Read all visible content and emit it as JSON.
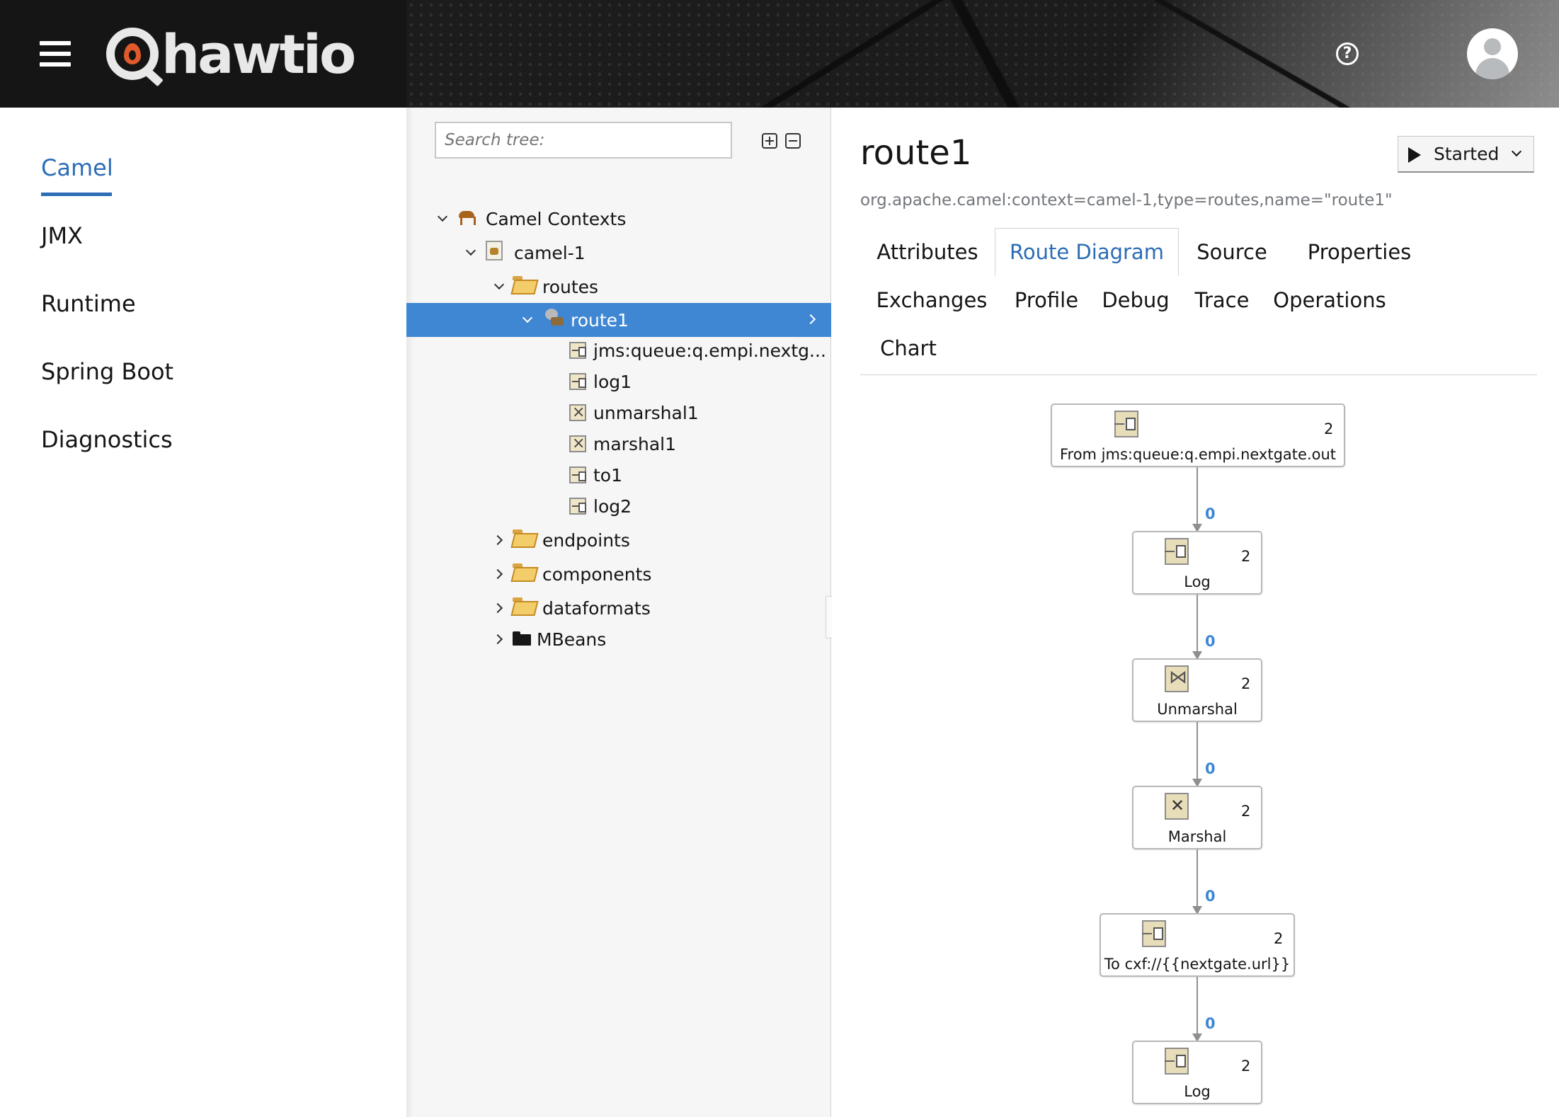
{
  "header": {
    "logo_text": "hawtio",
    "menu_icon": "hamburger-icon",
    "help_icon": "help-circle-icon",
    "avatar_icon": "user-avatar-icon"
  },
  "nav": {
    "active": "Camel",
    "items": [
      "Camel",
      "JMX",
      "Runtime",
      "Spring Boot",
      "Diagnostics"
    ]
  },
  "tree": {
    "search_placeholder": "Search tree:",
    "expand_all_icon": "plus-square-icon",
    "collapse_all_icon": "minus-square-icon",
    "rows": [
      {
        "label": "Camel Contexts",
        "icon": "camel-icon",
        "chevron": "down"
      },
      {
        "label": "camel-1",
        "icon": "context-icon",
        "chevron": "down"
      },
      {
        "label": "routes",
        "icon": "folder-open-icon",
        "chevron": "down"
      },
      {
        "label": "route1",
        "icon": "route-icon",
        "chevron": "down",
        "selected": true
      },
      {
        "label": "jms:queue:q.empi.nextg...",
        "icon": "endpoint-icon"
      },
      {
        "label": "log1",
        "icon": "endpoint-icon"
      },
      {
        "label": "unmarshal1",
        "icon": "dataformat-icon"
      },
      {
        "label": "marshal1",
        "icon": "dataformat-icon"
      },
      {
        "label": "to1",
        "icon": "endpoint-icon"
      },
      {
        "label": "log2",
        "icon": "endpoint-icon"
      },
      {
        "label": "endpoints",
        "icon": "folder-open-icon",
        "chevron": "right"
      },
      {
        "label": "components",
        "icon": "folder-open-icon",
        "chevron": "right"
      },
      {
        "label": "dataformats",
        "icon": "folder-open-icon",
        "chevron": "right"
      },
      {
        "label": "MBeans",
        "icon": "folder-icon",
        "chevron": "right"
      }
    ]
  },
  "main": {
    "title": "route1",
    "subtitle": "org.apache.camel:context=camel-1,type=routes,name=\"route1\"",
    "status_button": "Started",
    "tabs": [
      "Attributes",
      "Route Diagram",
      "Source",
      "Properties",
      "Exchanges",
      "Profile",
      "Debug",
      "Trace",
      "Operations",
      "Chart"
    ],
    "active_tab": "Route Diagram"
  },
  "diagram": {
    "nodes": [
      {
        "label": "From jms:queue:q.empi.nextgate.out",
        "count": "2",
        "icon": "endpoint-node-icon"
      },
      {
        "label": "Log",
        "count": "2",
        "icon": "endpoint-node-icon"
      },
      {
        "label": "Unmarshal",
        "count": "2",
        "icon": "unmarshal-node-icon"
      },
      {
        "label": "Marshal",
        "count": "2",
        "icon": "marshal-node-icon"
      },
      {
        "label": "To cxf://{{nextgate.url}}",
        "count": "2",
        "icon": "endpoint-node-icon"
      },
      {
        "label": "Log",
        "count": "2",
        "icon": "endpoint-node-icon"
      }
    ],
    "edges": [
      "0",
      "0",
      "0",
      "0",
      "0"
    ]
  },
  "colors": {
    "accent": "#2b6db6",
    "selected_row": "#3f87d3",
    "header_bg": "#151515"
  }
}
